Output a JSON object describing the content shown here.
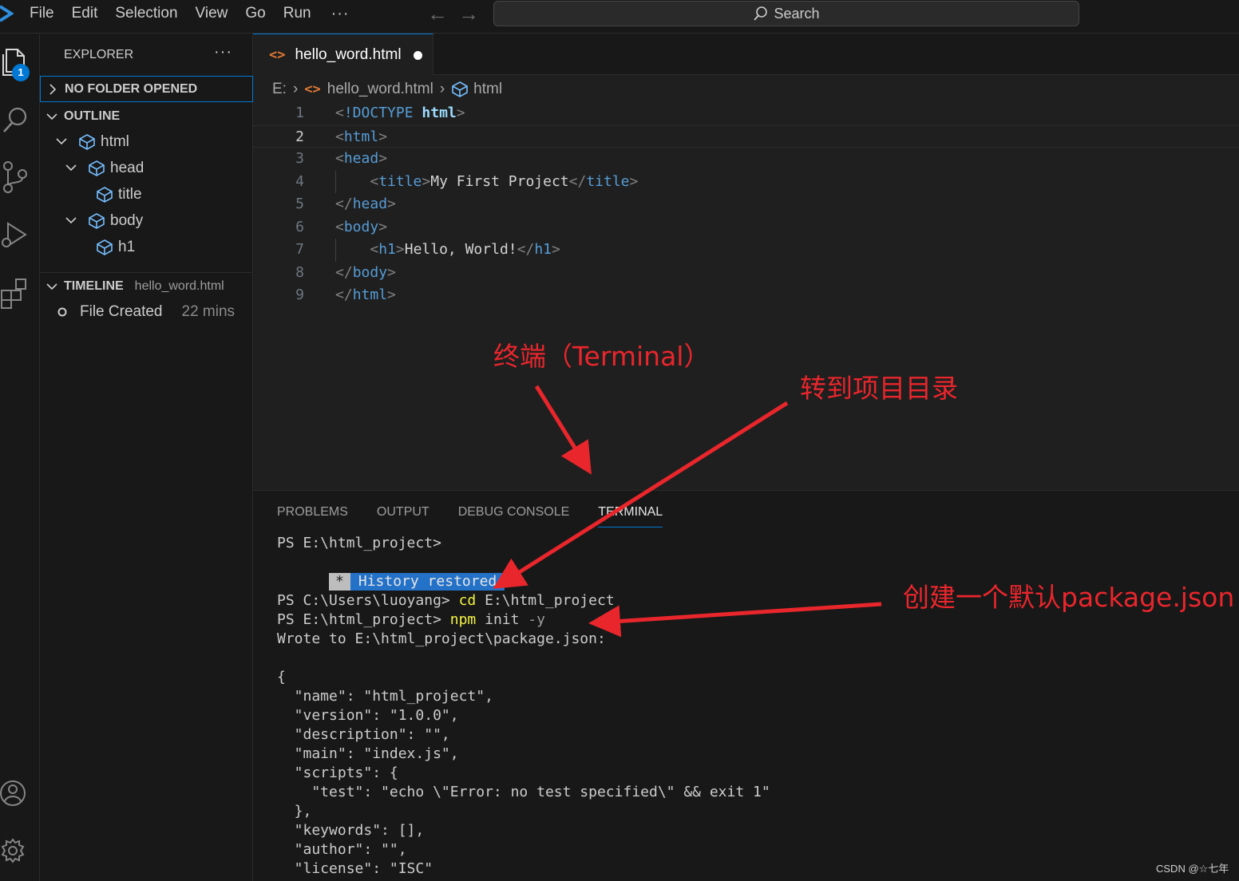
{
  "menu": {
    "items": [
      "File",
      "Edit",
      "Selection",
      "View",
      "Go",
      "Run"
    ],
    "more": "···"
  },
  "search": {
    "label": "Search"
  },
  "activity": {
    "explorer_badge": "1"
  },
  "explorer": {
    "title": "EXPLORER",
    "more": "···",
    "no_folder": "NO FOLDER OPENED",
    "outline": {
      "title": "OUTLINE",
      "items": [
        "html",
        "head",
        "title",
        "body",
        "h1"
      ]
    },
    "timeline": {
      "title": "TIMELINE",
      "file": "hello_word.html",
      "entry": "File Created",
      "time": "22 mins"
    }
  },
  "editor": {
    "tab_label": "hello_word.html",
    "breadcrumb": {
      "drive": "E:",
      "file": "hello_word.html",
      "symbol": "html"
    },
    "lines": [
      {
        "number": "1",
        "text": "<!DOCTYPE html>"
      },
      {
        "number": "2",
        "text": "<html>"
      },
      {
        "number": "3",
        "text": "<head>"
      },
      {
        "number": "4",
        "text": "    <title>My First Project</title>"
      },
      {
        "number": "5",
        "text": "</head>"
      },
      {
        "number": "6",
        "text": "<body>"
      },
      {
        "number": "7",
        "text": "    <h1>Hello, World!</h1>"
      },
      {
        "number": "8",
        "text": "</body>"
      },
      {
        "number": "9",
        "text": "</html>"
      }
    ],
    "colors": {
      "tag": "#569cd6",
      "bracket": "#808080",
      "keyword": "#569cd6"
    }
  },
  "panel": {
    "tabs": [
      "PROBLEMS",
      "OUTPUT",
      "DEBUG CONSOLE",
      "TERMINAL"
    ],
    "active_tab": "TERMINAL"
  },
  "terminal": {
    "prompt_initial": "PS E:\\html_project>",
    "history_star": "*",
    "history_text": "History restored",
    "cd_prompt": "PS C:\\Users\\luoyang> ",
    "cd_cmd": "cd",
    "cd_arg": " E:\\html_project",
    "npm_prompt": "PS E:\\html_project> ",
    "npm_cmd": "npm",
    "npm_arg": " init ",
    "npm_flag": "-y",
    "wrote": "Wrote to E:\\html_project\\package.json:",
    "json_lines": [
      "{",
      "  \"name\": \"html_project\",",
      "  \"version\": \"1.0.0\",",
      "  \"description\": \"\",",
      "  \"main\": \"index.js\",",
      "  \"scripts\": {",
      "    \"test\": \"echo \\\"Error: no test specified\\\" && exit 1\"",
      "  },",
      "  \"keywords\": [],",
      "  \"author\": \"\",",
      "  \"license\": \"ISC\""
    ]
  },
  "annotations": {
    "terminal_label": "终端（Terminal）",
    "cd_label": "转到项目目录",
    "npm_label": "创建一个默认package.json",
    "color": "#e8262c"
  },
  "watermark": "CSDN @☆七年"
}
